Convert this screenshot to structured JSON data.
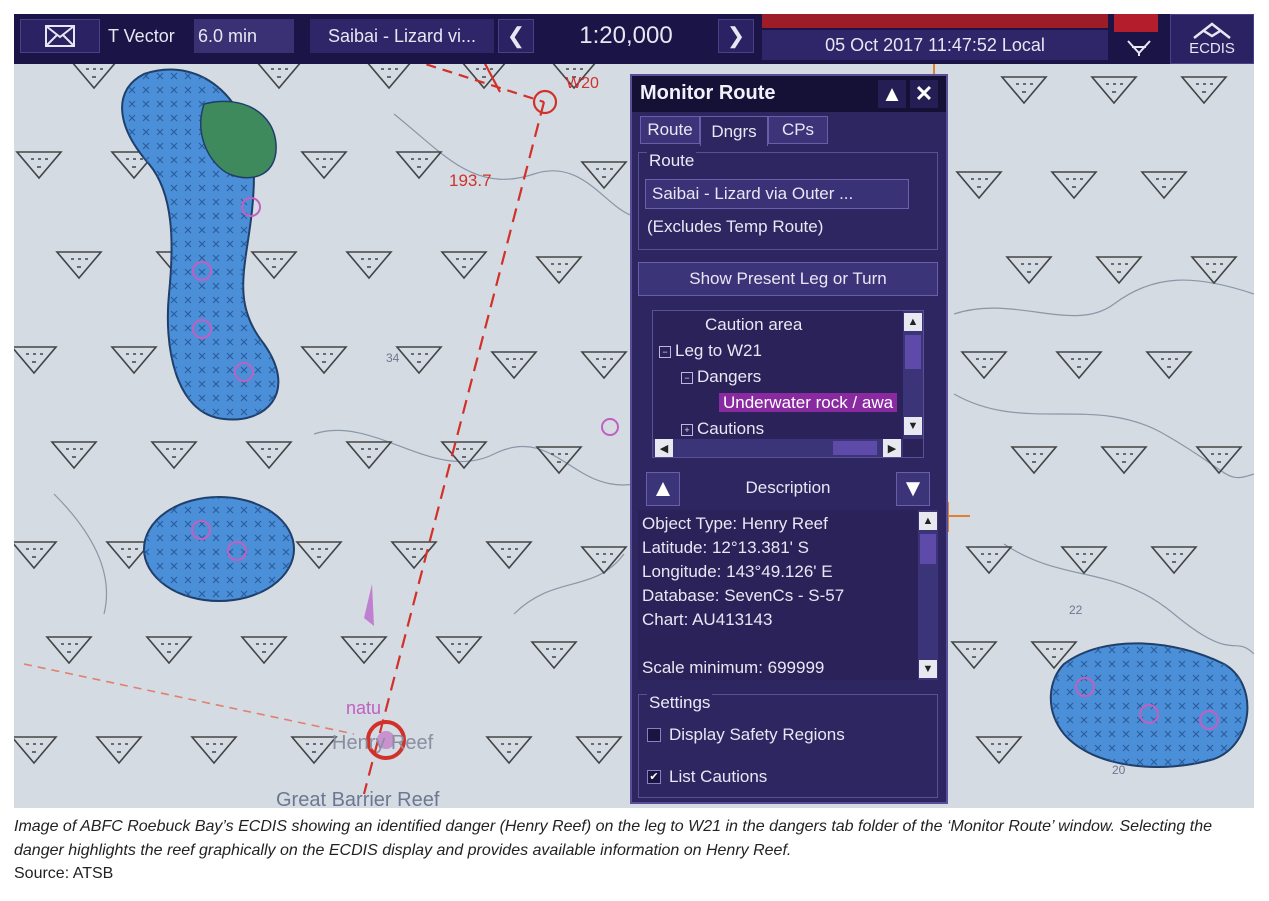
{
  "topbar": {
    "tvector_label": "T Vector",
    "tvector_value": "6.0 min",
    "route_name": "Saibai - Lizard vi...",
    "scale": "1:20,000",
    "datetime": "05 Oct 2017 11:47:52 Local",
    "ecdis_label": "ECDIS"
  },
  "chart": {
    "waypoint_label": "W20",
    "course_label": "193.7",
    "reef_label": "Henry Reef",
    "nature_label": "natu",
    "region_label": "Great Barrier Reef",
    "depth_labels": [
      "34",
      "22",
      "20"
    ]
  },
  "monitor_route": {
    "title": "Monitor Route",
    "tabs": [
      {
        "label": "Route",
        "active": false
      },
      {
        "label": "Dngrs",
        "active": true
      },
      {
        "label": "CPs",
        "active": false
      }
    ],
    "route_group_label": "Route",
    "route_field_value": "Saibai - Lizard via Outer ...",
    "route_excludes": "(Excludes Temp Route)",
    "show_leg_button": "Show Present Leg or Turn",
    "tree": [
      {
        "label": "Caution area"
      },
      {
        "label": "Leg to W21"
      },
      {
        "label": "Dangers"
      },
      {
        "label": "Underwater rock / awa",
        "selected": true
      },
      {
        "label": "Cautions"
      }
    ],
    "description_label": "Description",
    "description_lines": [
      "Object Type: Henry Reef",
      "Latitude: 12°13.381' S",
      "Longitude: 143°49.126' E",
      "Database: SevenCs - S-57",
      "Chart: AU413143",
      "Scale minimum: 699999"
    ],
    "settings_label": "Settings",
    "settings": [
      {
        "label": "Display Safety Regions",
        "checked": false
      },
      {
        "label": "List Cautions",
        "checked": true
      }
    ]
  },
  "caption": {
    "text": "Image of ABFC Roebuck Bay’s ECDIS showing an identified danger (Henry Reef) on the leg to W21 in the dangers tab folder of the ‘Monitor Route’ window. Selecting the danger highlights the reef graphically on the ECDIS display and provides available information on Henry Reef.",
    "source": "Source: ATSB"
  },
  "colors": {
    "panel_bg": "#2e2660",
    "topbar_bg": "#1b1446",
    "reef_fill": "#4a8fd8",
    "land_fill": "#3f8a5c",
    "route_line": "#d2312a",
    "highlight": "#8a2aa0"
  }
}
